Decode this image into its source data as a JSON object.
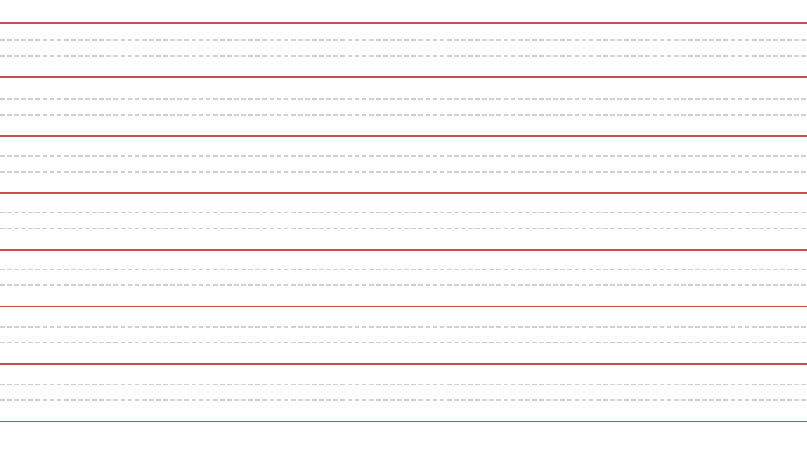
{
  "page": {
    "type": "handwriting-practice-sheet",
    "background_color": "#ffffff"
  },
  "rule_style": {
    "solid_line_color": "#b31717",
    "dashed_line_color": "#c2c2c2"
  },
  "writing_rows": {
    "count": 7,
    "lines_per_row": [
      "solid-top",
      "dashed-upper",
      "dashed-lower"
    ],
    "closing_line": "solid-bottom"
  }
}
